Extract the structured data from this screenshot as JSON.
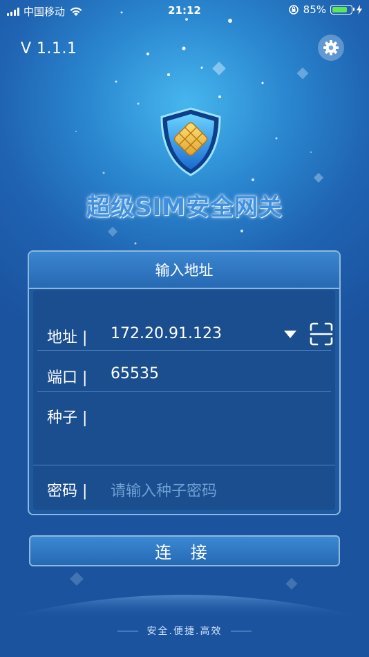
{
  "status_bar": {
    "carrier": "中国移动",
    "time": "21:12",
    "battery_percent": "85%",
    "battery_level": 0.85,
    "icons": [
      "signal-icon",
      "wifi-icon",
      "orientation-lock-icon",
      "battery-icon",
      "charging-icon"
    ]
  },
  "header": {
    "version": "V 1.1.1",
    "settings_icon": "gear-icon"
  },
  "brand": {
    "title": "超级SIM安全网关",
    "logo_icon": "shield-sim-icon"
  },
  "form": {
    "header_title": "输入地址",
    "address": {
      "label": "地址 |",
      "value": "172.20.91.123"
    },
    "port": {
      "label": "端口 |",
      "value": "65535"
    },
    "seed": {
      "label": "种子 |",
      "value": ""
    },
    "password": {
      "label": "密码 |",
      "placeholder": "请输入种子密码"
    }
  },
  "connect_button": {
    "label": "连 接"
  },
  "footer": {
    "slogan": "安全.便捷.高效"
  },
  "colors": {
    "background": "#1f63b2",
    "accent": "#3c88d2",
    "battery_fill": "#5ee65a",
    "placeholder": "#6f9fd3"
  }
}
